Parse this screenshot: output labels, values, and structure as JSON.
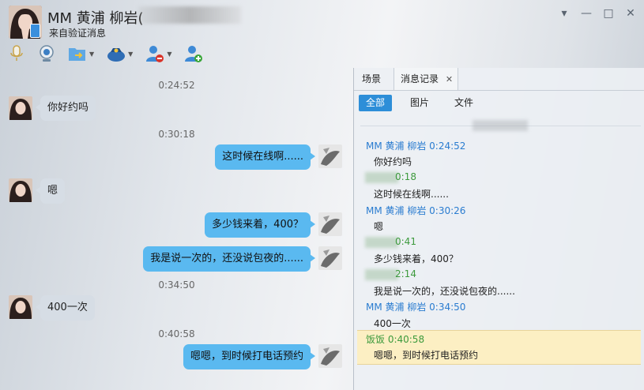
{
  "window": {
    "contact_name": "MM  黄浦   柳岩(",
    "subtitle": "来自验证消息",
    "controls": [
      "▾",
      "—",
      "□",
      "✕"
    ]
  },
  "toolbar": {
    "tools": [
      "microphone-icon",
      "video-camera-icon",
      "send-file-icon",
      "remote-assist-icon",
      "remove-contact-icon",
      "add-contact-icon"
    ]
  },
  "chat": {
    "messages": [
      {
        "kind": "time",
        "text": "0:24:52"
      },
      {
        "kind": "in",
        "text": "你好约吗"
      },
      {
        "kind": "time",
        "text": "0:30:18"
      },
      {
        "kind": "out",
        "text": "这时候在线啊......"
      },
      {
        "kind": "in",
        "text": "嗯"
      },
      {
        "kind": "out",
        "text": "多少钱来着，400？"
      },
      {
        "kind": "out",
        "text": "我是说一次的，还没说包夜的......"
      },
      {
        "kind": "time",
        "text": "0:34:50"
      },
      {
        "kind": "in",
        "text": "400一次"
      },
      {
        "kind": "time",
        "text": "0:40:58"
      },
      {
        "kind": "out",
        "text": "嗯嗯，到时候打电话预约"
      }
    ]
  },
  "panel": {
    "tabs": [
      "场景",
      "消息记录"
    ],
    "close_glyph": "✕",
    "filters": [
      "全部",
      "图片",
      "文件"
    ],
    "history": [
      {
        "header": "MM  黄浦    柳岩 0:24:52",
        "text": "你好约吗",
        "self": false
      },
      {
        "header": "0:18",
        "text": "这时候在线啊......",
        "self": true
      },
      {
        "header": "MM  黄浦    柳岩 0:30:26",
        "text": "嗯",
        "self": false
      },
      {
        "header": "0:41",
        "text": "多少钱来着，400？",
        "self": true
      },
      {
        "header": "2:14",
        "text": "我是说一次的，还没说包夜的......",
        "self": true
      },
      {
        "header": "MM  黄浦    柳岩 0:34:50",
        "text": "400一次",
        "self": false
      },
      {
        "header": "饭饭 0:40:58",
        "text": "嗯嗯，到时候打电话预约",
        "self": true
      }
    ]
  },
  "colors": {
    "accent": "#2d8ed8",
    "outgoing_bubble": "#5ab9f0",
    "incoming_bubble": "#d6dde5",
    "history_name": "#2a7cd0",
    "history_self": "#3d9a3d",
    "highlight": "#fcefc3"
  }
}
